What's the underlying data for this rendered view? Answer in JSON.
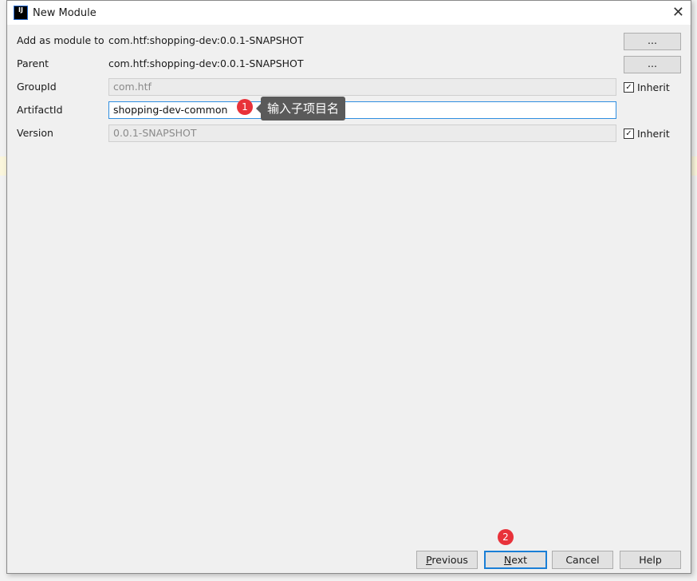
{
  "window": {
    "title": "New Module",
    "logo": "IJ"
  },
  "form": {
    "add_as_module_label": "Add as module to",
    "add_as_module_value": "com.htf:shopping-dev:0.0.1-SNAPSHOT",
    "parent_label": "Parent",
    "parent_value": "com.htf:shopping-dev:0.0.1-SNAPSHOT",
    "groupid_label": "GroupId",
    "groupid_value": "com.htf",
    "artifactid_label": "ArtifactId",
    "artifactid_value": "shopping-dev-common",
    "version_label": "Version",
    "version_value": "0.0.1-SNAPSHOT",
    "browse_label": "...",
    "inherit_label": "Inherit",
    "groupid_inherit": true,
    "version_inherit": true
  },
  "annotations": {
    "badge1": "1",
    "tooltip1": "输入子项目名",
    "badge2": "2"
  },
  "buttons": {
    "previous_mn": "P",
    "previous_rest": "revious",
    "next_mn": "N",
    "next_rest": "ext",
    "cancel": "Cancel",
    "help": "Help"
  }
}
